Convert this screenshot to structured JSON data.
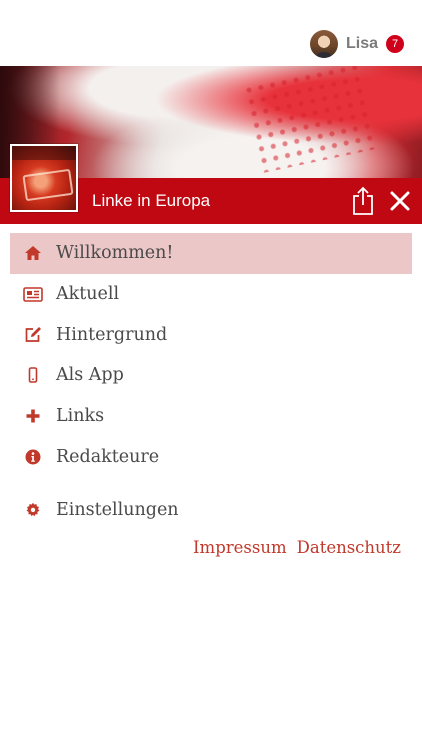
{
  "user": {
    "name": "Lisa",
    "notification_count": "7"
  },
  "header": {
    "title": "Linke in Europa"
  },
  "menu": {
    "items": [
      {
        "label": "Willkommen!",
        "icon": "home-icon",
        "active": true
      },
      {
        "label": "Aktuell",
        "icon": "newspaper-icon"
      },
      {
        "label": "Hintergrund",
        "icon": "edit-icon"
      },
      {
        "label": "Als App",
        "icon": "mobile-icon"
      },
      {
        "label": "Links",
        "icon": "plus-icon"
      },
      {
        "label": "Redakteure",
        "icon": "info-icon"
      }
    ],
    "settings": {
      "label": "Einstellungen",
      "icon": "gear-icon"
    }
  },
  "footer": {
    "impressum": "Impressum",
    "datenschutz": "Datenschutz"
  },
  "colors": {
    "accent": "#c00812",
    "active_bg": "#ecc7c7",
    "icon": "#c0392b",
    "badge": "#d0021b"
  }
}
